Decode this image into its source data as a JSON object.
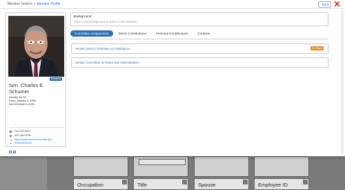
{
  "breadcrumb": {
    "items": [
      "Member Search",
      "Member Profile"
    ],
    "separator": ">"
  },
  "header": {
    "back_label": "Back"
  },
  "profile": {
    "badge": "Democrat",
    "name": "Sen. Charles E. Schumer",
    "state_line": "Senator for NY",
    "since_line": "Since January 6, 1999",
    "next_election": "Next Election in 2028",
    "phone": "202-224-6542",
    "office": "322 Hart SOB",
    "website": "https://www.schumer.senate.gov",
    "twitter": "@SenSchumer"
  },
  "background": {
    "title": "Background",
    "placeholder": "Click to add background or notes for this Member."
  },
  "tabs": [
    {
      "label": "Committee Assignments",
      "active": true
    },
    {
      "label": "Direct Contributions",
      "active": false
    },
    {
      "label": "Personal Contributions",
      "active": false
    },
    {
      "label": "Contacts",
      "active": false
    }
  ],
  "committees": [
    {
      "name": "Senate Select Committee on Intelligence",
      "badge": "Ex Officio"
    },
    {
      "name": "Senate Committee on Rules and Administration",
      "badge": ""
    }
  ],
  "background_page": {
    "field_labels": [
      "Occupation",
      "Title",
      "Spouse",
      "Employee ID"
    ]
  },
  "colors": {
    "accent": "#2c6fb7",
    "exofficio": "#e98a1c",
    "close": "#d62020"
  }
}
